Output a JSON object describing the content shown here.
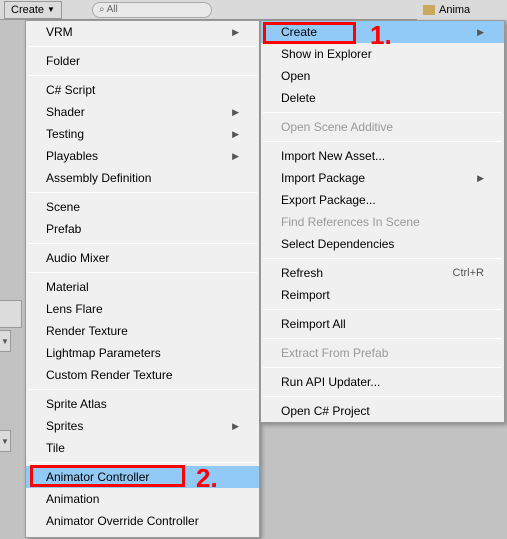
{
  "topbar": {
    "create_label": "Create",
    "search_placeholder": "All",
    "folder_label": "Anima"
  },
  "left_menu": {
    "items": [
      {
        "label": "VRM",
        "sub": true
      },
      {
        "sep": true
      },
      {
        "label": "Folder"
      },
      {
        "sep": true
      },
      {
        "label": "C# Script"
      },
      {
        "label": "Shader",
        "sub": true
      },
      {
        "label": "Testing",
        "sub": true
      },
      {
        "label": "Playables",
        "sub": true
      },
      {
        "label": "Assembly Definition"
      },
      {
        "sep": true
      },
      {
        "label": "Scene"
      },
      {
        "label": "Prefab"
      },
      {
        "sep": true
      },
      {
        "label": "Audio Mixer"
      },
      {
        "sep": true
      },
      {
        "label": "Material"
      },
      {
        "label": "Lens Flare"
      },
      {
        "label": "Render Texture"
      },
      {
        "label": "Lightmap Parameters"
      },
      {
        "label": "Custom Render Texture"
      },
      {
        "sep": true
      },
      {
        "label": "Sprite Atlas"
      },
      {
        "label": "Sprites",
        "sub": true
      },
      {
        "label": "Tile"
      },
      {
        "sep": true
      },
      {
        "label": "Animator Controller",
        "hl": true
      },
      {
        "label": "Animation"
      },
      {
        "label": "Animator Override Controller"
      }
    ]
  },
  "right_menu": {
    "items": [
      {
        "label": "Create",
        "sub": true,
        "hl": true
      },
      {
        "label": "Show in Explorer"
      },
      {
        "label": "Open"
      },
      {
        "label": "Delete"
      },
      {
        "sep": true
      },
      {
        "label": "Open Scene Additive",
        "disabled": true
      },
      {
        "sep": true
      },
      {
        "label": "Import New Asset..."
      },
      {
        "label": "Import Package",
        "sub": true
      },
      {
        "label": "Export Package..."
      },
      {
        "label": "Find References In Scene",
        "disabled": true
      },
      {
        "label": "Select Dependencies"
      },
      {
        "sep": true
      },
      {
        "label": "Refresh",
        "shortcut": "Ctrl+R"
      },
      {
        "label": "Reimport"
      },
      {
        "sep": true
      },
      {
        "label": "Reimport All"
      },
      {
        "sep": true
      },
      {
        "label": "Extract From Prefab",
        "disabled": true
      },
      {
        "sep": true
      },
      {
        "label": "Run API Updater..."
      },
      {
        "sep": true
      },
      {
        "label": "Open C# Project"
      }
    ]
  },
  "annotations": {
    "label1": "1.",
    "label2": "2."
  }
}
